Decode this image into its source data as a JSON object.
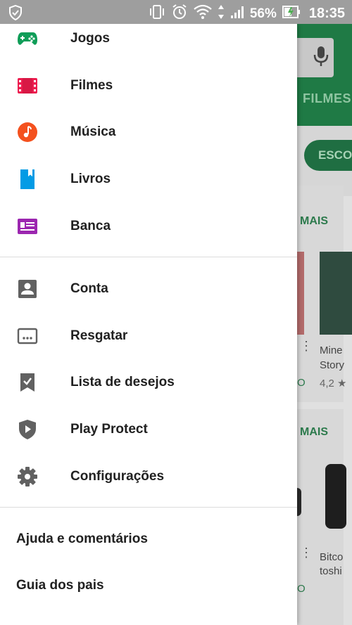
{
  "status_bar": {
    "battery": "56%",
    "time": "18:35"
  },
  "drawer": {
    "primary_items": [
      {
        "label": "Jogos",
        "icon": "gamepad-icon",
        "color": "#0f9d58"
      },
      {
        "label": "Filmes",
        "icon": "film-icon",
        "color": "#ed1c4f"
      },
      {
        "label": "Música",
        "icon": "music-icon",
        "color": "#f4511e"
      },
      {
        "label": "Livros",
        "icon": "book-icon",
        "color": "#039be5"
      },
      {
        "label": "Banca",
        "icon": "newsstand-icon",
        "color": "#9c27b0"
      }
    ],
    "secondary_items": [
      {
        "label": "Conta",
        "icon": "account-icon",
        "color": "#616161"
      },
      {
        "label": "Resgatar",
        "icon": "redeem-icon",
        "color": "#616161"
      },
      {
        "label": "Lista de desejos",
        "icon": "wishlist-icon",
        "color": "#616161"
      },
      {
        "label": "Play Protect",
        "icon": "shield-icon",
        "color": "#616161"
      },
      {
        "label": "Configurações",
        "icon": "gear-icon",
        "color": "#616161"
      }
    ],
    "footer_items": [
      {
        "label": "Ajuda e comentários"
      },
      {
        "label": "Guia dos pais"
      }
    ]
  },
  "background": {
    "tab_label": "FILMES",
    "chip_label": "ESCO",
    "more_label_1": "MAIS",
    "more_label_2": "MAIS",
    "card1_title_line1": "Mine",
    "card1_title_line2": "Story",
    "card1_rating": "4,2 ★",
    "card1_price": "O",
    "card2_title_line1": "Bitco",
    "card2_title_line2": "toshi",
    "card2_price": "O"
  }
}
